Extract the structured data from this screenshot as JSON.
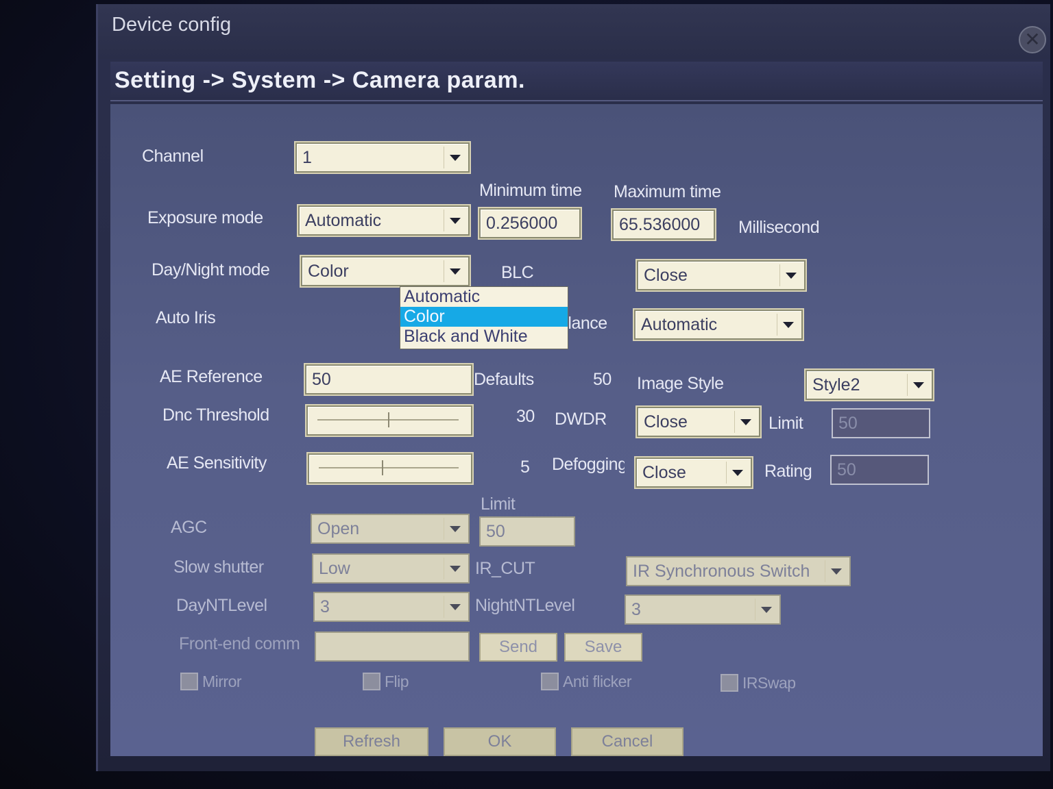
{
  "window": {
    "title": "Device config",
    "close_icon": "close-icon"
  },
  "breadcrumb": "Setting -> System -> Camera param.",
  "channel": {
    "label": "Channel",
    "value": "1"
  },
  "exposure": {
    "label": "Exposure mode",
    "value": "Automatic",
    "min_label": "Minimum time",
    "min_value": "0.256000",
    "max_label": "Maximum time",
    "max_value": "65.536000",
    "unit": "Millisecond"
  },
  "day_night": {
    "label": "Day/Night mode",
    "value": "Color",
    "options": [
      "Automatic",
      "Color",
      "Black and White"
    ],
    "selected_index": 1
  },
  "auto_iris": {
    "label": "Auto Iris"
  },
  "blc": {
    "label": "BLC",
    "value": "Close"
  },
  "white_balance": {
    "label": "White Balance",
    "value": "Automatic"
  },
  "ae_reference": {
    "label": "AE Reference",
    "value": "50",
    "defaults_label": "Defaults",
    "defaults_value": "50"
  },
  "image_style": {
    "label": "Image Style",
    "value": "Style2"
  },
  "dnc_threshold": {
    "label": "Dnc Threshold",
    "value": "30",
    "level": 0.5
  },
  "dwdr": {
    "label": "DWDR",
    "value": "Close",
    "limit_label": "Limit",
    "limit_value": "50"
  },
  "ae_sensitivity": {
    "label": "AE Sensitivity",
    "value": "5",
    "level": 0.45
  },
  "defogging": {
    "label": "Defogging",
    "value": "Close",
    "rating_label": "Rating",
    "rating_value": "50"
  },
  "agc": {
    "label": "AGC",
    "value": "Open",
    "limit_label": "Limit",
    "limit_value": "50"
  },
  "slow_shutter": {
    "label": "Slow shutter",
    "value": "Low"
  },
  "ir_cut": {
    "label": "IR_CUT",
    "value": "IR Synchronous Switch"
  },
  "day_nt_level": {
    "label": "DayNTLevel",
    "value": "3"
  },
  "night_nt_level": {
    "label": "NightNTLevel",
    "value": "3"
  },
  "front_end": {
    "label": "Front-end comm",
    "value": "",
    "send_label": "Send",
    "save_label": "Save"
  },
  "checkboxes": {
    "mirror": "Mirror",
    "flip": "Flip",
    "anti_flicker": "Anti flicker",
    "irswap": "IRSwap"
  },
  "buttons": {
    "refresh": "Refresh",
    "ok": "OK",
    "cancel": "Cancel"
  },
  "colors": {
    "selection": "#16a9e6",
    "field": "#f4f0dc",
    "panel": "#565e88"
  }
}
